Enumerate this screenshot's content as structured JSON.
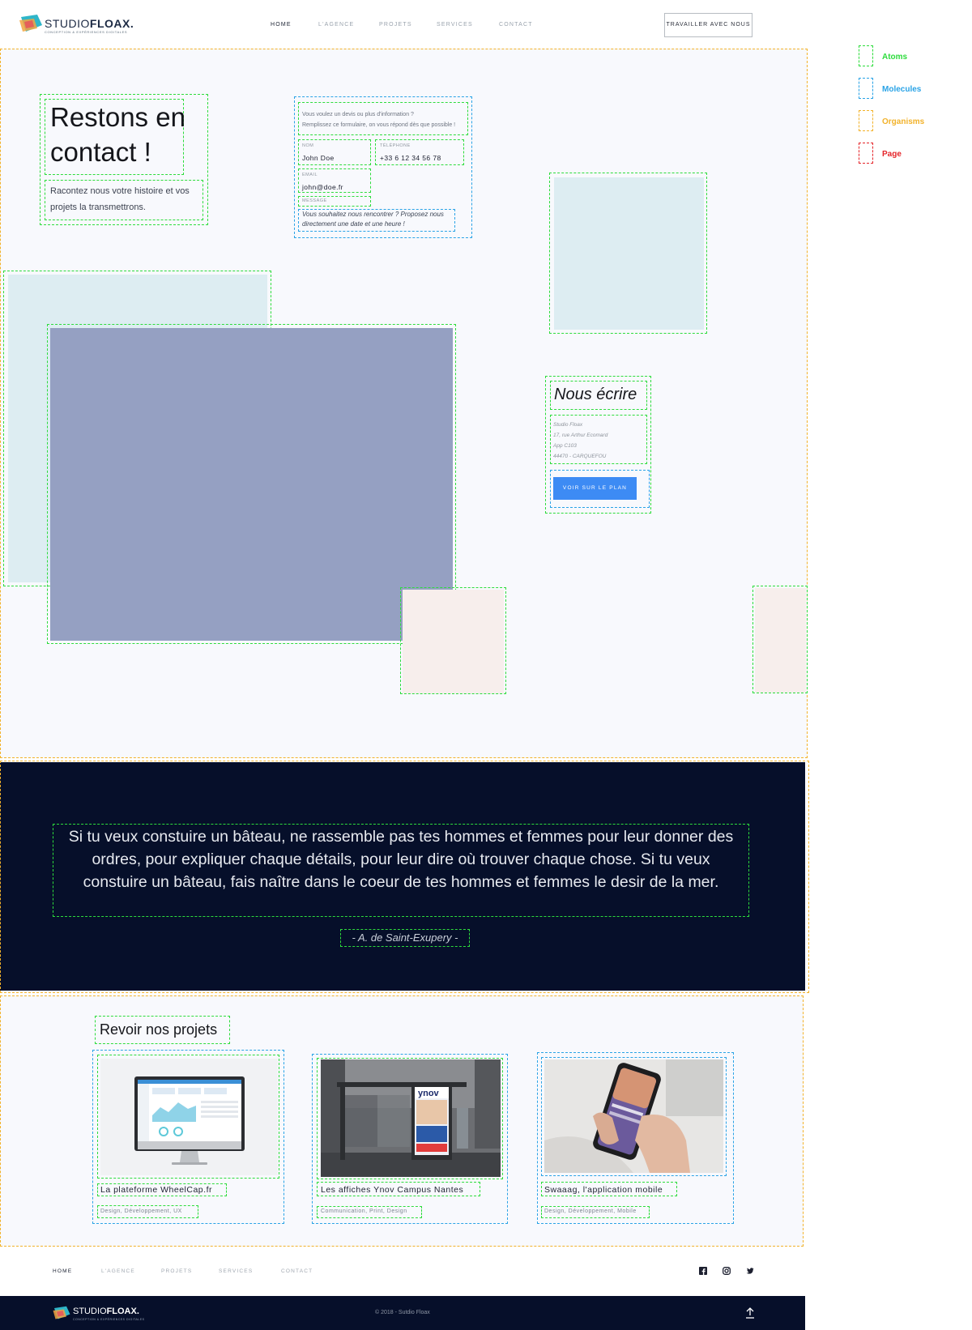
{
  "brand": {
    "name_light": "STUDIO",
    "name_bold": "FLOAX.",
    "tagline": "Conception & Expériences Digitales"
  },
  "nav": {
    "items": [
      {
        "label": "HOME"
      },
      {
        "label": "L'AGENCE"
      },
      {
        "label": "PROJETS"
      },
      {
        "label": "SERVICES"
      },
      {
        "label": "CONTACT"
      }
    ],
    "cta": "TRAVAILLER AVEC NOUS"
  },
  "legend": [
    {
      "label": "Atoms",
      "color": "#2ddc3c"
    },
    {
      "label": "Molecules",
      "color": "#2aa3e6"
    },
    {
      "label": "Organisms",
      "color": "#f2b22a"
    },
    {
      "label": "Page",
      "color": "#e5252a"
    }
  ],
  "contact": {
    "title_line1": "Restons en",
    "title_line2": "contact !",
    "intro": "Racontez nous votre histoire et vos projets la transmettrons.",
    "form": {
      "intro_line1": "Vous voulez un devis ou plus d'information ?",
      "intro_line2": "Remplissez ce formulaire, on vous répond dès que possible !",
      "name_label": "NOM",
      "name_value": "John Doe",
      "phone_label": "TÉLÉPHONE",
      "phone_value": "+33 6 12 34 56 78",
      "email_label": "EMAIL",
      "email_value": "john@doe.fr",
      "message_label": "MESSAGE",
      "message_value": "Vous souhaitez nous rencontrer ? Proposez nous directement une date et une heure !"
    }
  },
  "write": {
    "title": "Nous écrire",
    "address": [
      "Studio Floax",
      "17, rue Arthur Ecomard",
      "App C103",
      "44470 - CARQUEFOU"
    ],
    "button": "VOIR SUR LE PLAN"
  },
  "quote": {
    "text": "Si tu veux constuire un bâteau, ne rassemble pas tes hommes et femmes pour leur donner des ordres, pour expliquer chaque détails, pour leur dire où trouver chaque chose. Si tu veux constuire un bâteau, fais naître dans le coeur de tes hommes et femmes le desir de la mer.",
    "author": "- A. de Saint-Exupery -"
  },
  "projects": {
    "title": "Revoir nos projets",
    "items": [
      {
        "title": "La plateforme WheelCap.fr",
        "tags": "Design, Développement, UX"
      },
      {
        "title": "Les affiches Ynov Campus Nantes",
        "tags": "Communication, Print, Design"
      },
      {
        "title": "Swaaag, l'application mobile",
        "tags": "Design, Développement, Mobile"
      }
    ]
  },
  "footer": {
    "nav": [
      {
        "label": "HOME"
      },
      {
        "label": "L'AGENCE"
      },
      {
        "label": "PROJETS"
      },
      {
        "label": "SERVICES"
      },
      {
        "label": "CONTACT"
      }
    ],
    "social_icons": [
      "facebook-icon",
      "instagram-icon",
      "twitter-icon"
    ],
    "copyright": "© 2018 - Sutdio Floax"
  },
  "colors": {
    "atoms": "#2ddc3c",
    "molecules": "#2aa3e6",
    "organisms": "#f2b22a",
    "page": "#e5252a",
    "dark_navy": "#060f2a",
    "accent_blue": "#3d8bf4",
    "placeholder_light_blue": "#ddedf2",
    "placeholder_slate": "#95a0c2",
    "placeholder_pink": "#f7eeec"
  }
}
